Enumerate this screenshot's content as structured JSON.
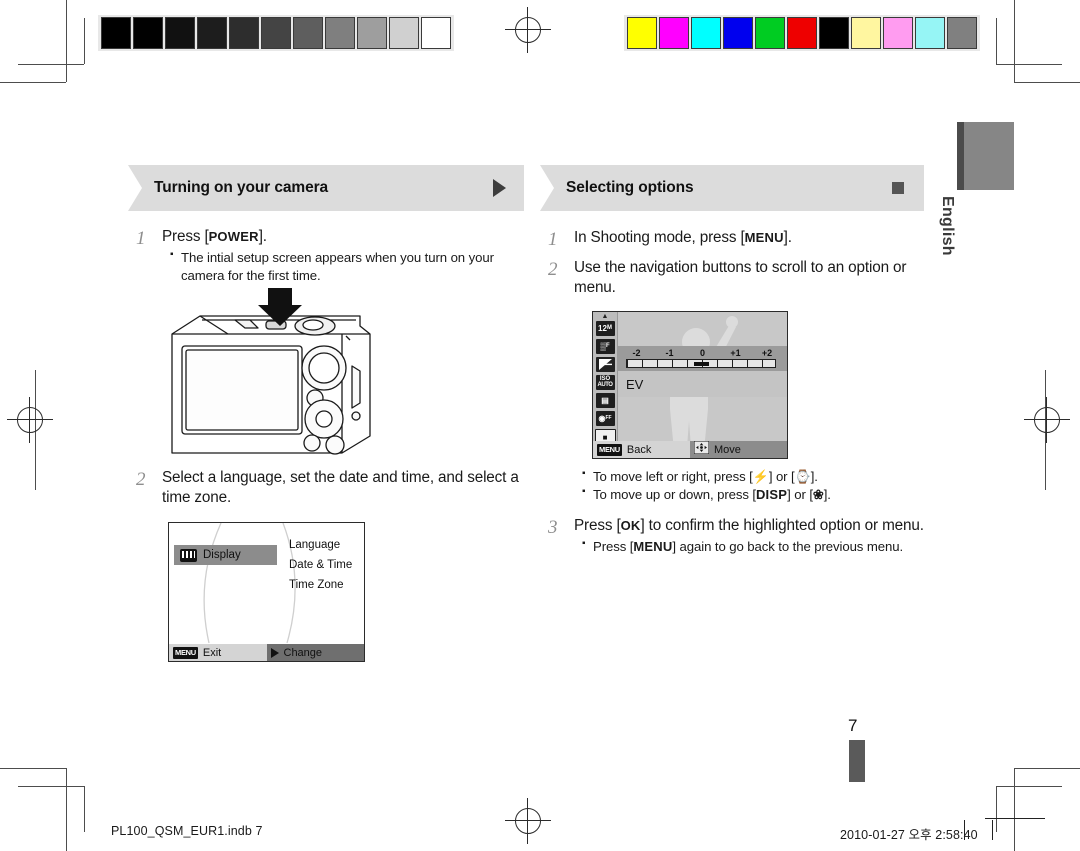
{
  "document": {
    "language_tab": "English",
    "page_number": "7",
    "footer_left": "PL100_QSM_EUR1.indb   7",
    "footer_right": "2010-01-27   오후 2:58:40"
  },
  "calibration": {
    "gray_swatches": [
      "#000000",
      "#010101",
      "#111111",
      "#1d1d1d",
      "#2d2d2d",
      "#444444",
      "#5e5e5e",
      "#7f7f7f",
      "#9e9e9e",
      "#d0d0d0",
      "#ffffff"
    ],
    "color_swatches": [
      "#ffff00",
      "#ff00ff",
      "#00ffff",
      "#0000ee",
      "#00cc22",
      "#ee0000",
      "#000000",
      "#fff6a0",
      "#ff9cf0",
      "#96f5f5",
      "#808080"
    ]
  },
  "left_column": {
    "header": {
      "title": "Turning on your camera",
      "marker_icon": "triangle-right-icon"
    },
    "steps": [
      {
        "number": "1",
        "text_parts": [
          {
            "t": "Press [",
            "bold": false
          },
          {
            "t": "POWER",
            "bold": true
          },
          {
            "t": "].",
            "bold": false
          }
        ],
        "bullets": [
          "The intial setup screen appears when you turn on your camera for the first time."
        ]
      },
      {
        "number": "2",
        "text": "Select a language, set the date and time, and select a time zone.",
        "bullets": []
      }
    ],
    "camera_illustration": {
      "name": "camera-rear-view",
      "callout": "down-arrow-to-power-button"
    },
    "display_menu_screen": {
      "selected_item": "Display",
      "selected_item_icon": "display-icon",
      "submenu_items": [
        "Language",
        "Date & Time",
        "Time Zone"
      ],
      "bottom_bar": {
        "left_chip": "MENU",
        "left_label": "Exit",
        "right_icon": "triangle-right-icon",
        "right_label": "Change"
      }
    }
  },
  "right_column": {
    "header": {
      "title": "Selecting options",
      "marker_icon": "square-icon"
    },
    "steps": [
      {
        "number": "1",
        "text_parts": [
          {
            "t": "In Shooting mode, press [",
            "bold": false
          },
          {
            "t": "MENU",
            "bold": true
          },
          {
            "t": "].",
            "bold": false
          }
        ],
        "bullets": []
      },
      {
        "number": "2",
        "text": "Use the navigation buttons to scroll to an option or menu.",
        "bullets_after_image": [
          {
            "parts": [
              {
                "t": "To move left or right, press [",
                "kind": "plain"
              },
              {
                "t": "⚡",
                "kind": "glyph",
                "icon": "flash-icon"
              },
              {
                "t": "] or [",
                "kind": "plain"
              },
              {
                "t": "⏱",
                "kind": "glyph",
                "icon": "timer-icon"
              },
              {
                "t": "].",
                "kind": "plain"
              }
            ]
          },
          {
            "parts": [
              {
                "t": "To move up or down, press [",
                "kind": "plain"
              },
              {
                "t": "DISP",
                "kind": "bold"
              },
              {
                "t": "] or [",
                "kind": "plain"
              },
              {
                "t": "❀",
                "kind": "glyph",
                "icon": "macro-flower-icon"
              },
              {
                "t": "].",
                "kind": "plain"
              }
            ]
          }
        ]
      },
      {
        "number": "3",
        "text_parts": [
          {
            "t": "Press [",
            "bold": false
          },
          {
            "t": "OK",
            "bold": true
          },
          {
            "t": "] to confirm the highlighted option or menu.",
            "bold": false
          }
        ],
        "bullets": [
          {
            "parts": [
              {
                "t": "Press [",
                "kind": "plain"
              },
              {
                "t": "MENU",
                "kind": "bold"
              },
              {
                "t": "] again to go back to the previous menu.",
                "kind": "plain"
              }
            ]
          }
        ]
      }
    ],
    "ev_screen": {
      "sidebar_icons": [
        {
          "name": "resolution-12m-icon",
          "label": "12ᴹ"
        },
        {
          "name": "quality-f-icon",
          "label": "▒F"
        },
        {
          "name": "ev-exposure-icon",
          "label": "±",
          "selected": true
        },
        {
          "name": "iso-auto-icon",
          "label": "ISO"
        },
        {
          "name": "white-balance-icon",
          "label": "▤"
        },
        {
          "name": "face-detection-off-icon",
          "label": "☉F"
        },
        {
          "name": "focus-area-icon",
          "label": "□"
        }
      ],
      "scale_labels": [
        "-2",
        "-1",
        "0",
        "+1",
        "+2"
      ],
      "scale_value": "0",
      "option_label": "EV",
      "bottom_bar": {
        "left_chip": "MENU",
        "left_label": "Back",
        "right_icon": "dpad-icon",
        "right_label": "Move"
      }
    }
  }
}
